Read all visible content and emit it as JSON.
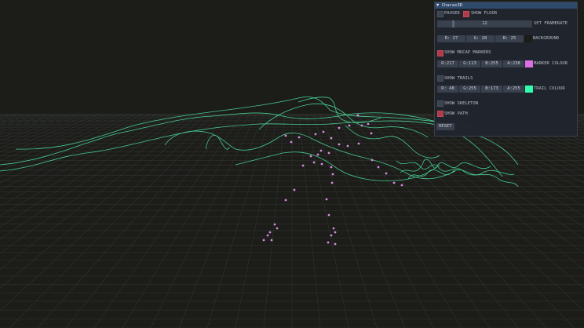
{
  "colors": {
    "background": "#1c1c19",
    "grid": "#2f3330",
    "trail": "#4bdc9b",
    "marker": "#d98ae2",
    "checkbox_on": "#b03a48",
    "marker_swatch": "#d971e4",
    "trail_swatch": "#30ffad"
  },
  "panel": {
    "title": "▼ Charas3D",
    "paused_label": "PAUSED",
    "show_floor_label": "SHOW FLOOR",
    "framerate_value": "12",
    "framerate_fraction": 0.12,
    "set_framerate_label": "SET FRAMERATE",
    "bg_r": "R: 27",
    "bg_g": "G: 28",
    "bg_b": "B: 25",
    "background_label": "BACKGROUND",
    "show_mocap_label": "SHOW MOCAP MARKERS",
    "marker_r": "R:217",
    "marker_g": "G:113",
    "marker_b": "B:255",
    "marker_a": "A:238",
    "marker_colour_label": "MARKER COLOUR",
    "show_trails_label": "SHOW TRAILS",
    "trail_r": "R: 48",
    "trail_g": "G:255",
    "trail_b": "B:173",
    "trail_a": "A:255",
    "trail_colour_label": "TRAIL COLOUR",
    "show_skeleton_label": "SHOW SKELETON",
    "show_path_label": "SHOW PATH",
    "reset_label": "RESET"
  }
}
